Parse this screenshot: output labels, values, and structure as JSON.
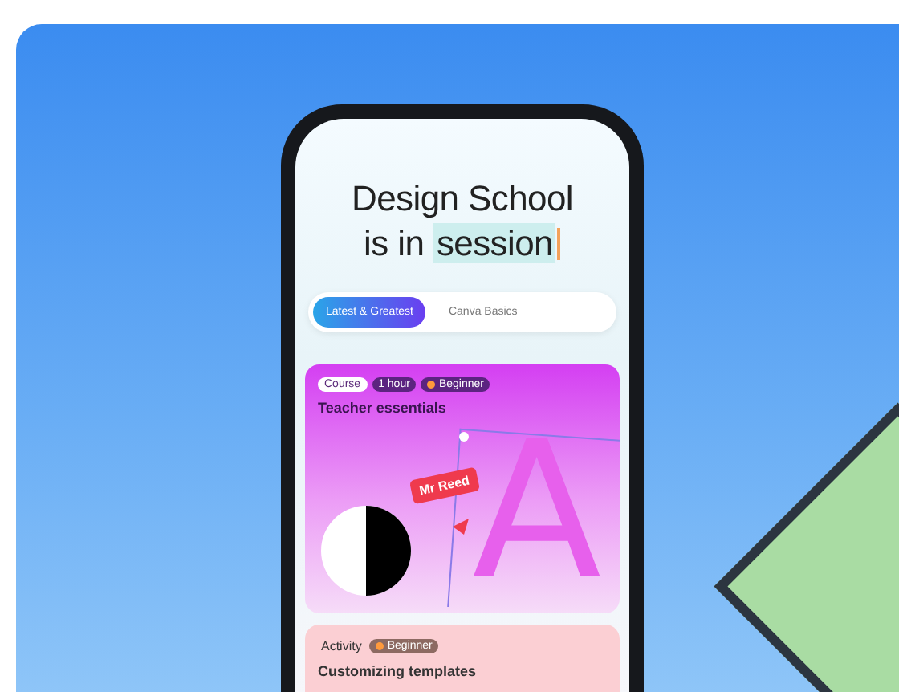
{
  "headline": {
    "line_1": "Design School",
    "line_2_prefix": "is in",
    "line_2_highlight": "session"
  },
  "tabs": [
    {
      "label": "Latest & Greatest",
      "selected": true
    },
    {
      "label": "Canva Basics",
      "selected": false
    }
  ],
  "cards": [
    {
      "kind": "course",
      "badges": [
        {
          "label": "Course",
          "kind": "type"
        },
        {
          "label": "1 hour",
          "kind": "duration"
        },
        {
          "label": "Beginner",
          "kind": "level"
        }
      ],
      "title": "Teacher essentials",
      "name_tag": "Mr Reed",
      "letter": "A"
    },
    {
      "kind": "activity",
      "badges": [
        {
          "label": "Activity",
          "kind": "type"
        },
        {
          "label": "Beginner",
          "kind": "level"
        }
      ],
      "title": "Customizing templates"
    }
  ]
}
